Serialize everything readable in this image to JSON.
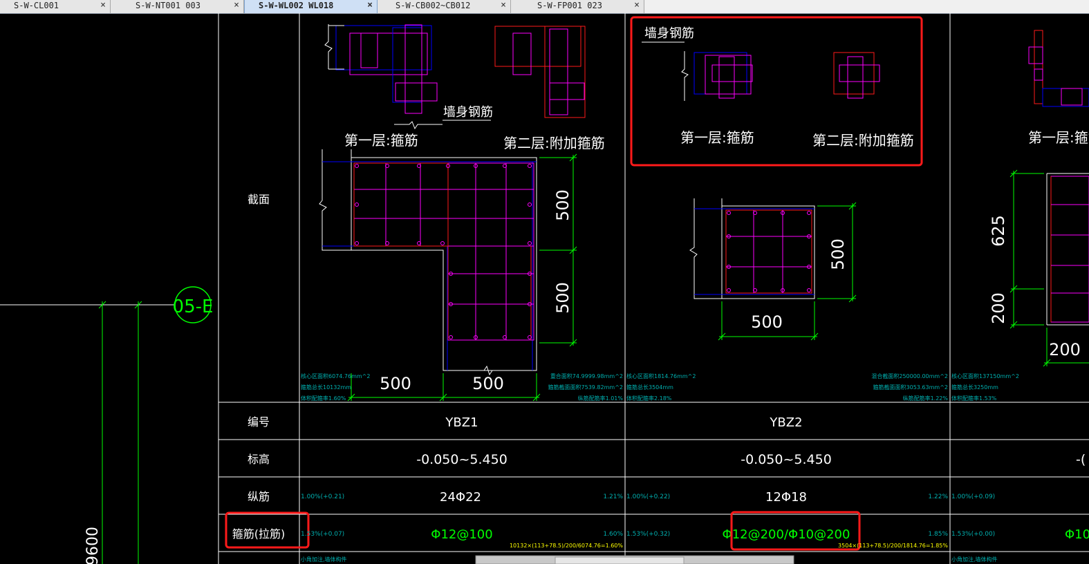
{
  "tabs": [
    {
      "label": "S-W-CL001",
      "active": false
    },
    {
      "label": "S-W-NT001 003",
      "active": false
    },
    {
      "label": "S-W-WL002 WL018",
      "active": true
    },
    {
      "label": "S-W-CB002~CB012",
      "active": false
    },
    {
      "label": "S-W-FP001 023",
      "active": false
    }
  ],
  "close_glyph": "×",
  "drawing": {
    "axis_bubble": "05-E",
    "left_dimension": "9600",
    "row_section": "截面",
    "row_id": "编号",
    "row_elevation": "标高",
    "row_long_bars": "纵筋",
    "row_stirrups": "箍筋(拉筋)",
    "wall_rebar": "墙身钢筋",
    "layer1": "第一层:箍筋",
    "layer2": "第二层:附加箍筋",
    "dims": {
      "d500": "500",
      "d625": "625",
      "d200": "200"
    },
    "col1": {
      "id": "YBZ1",
      "elevation": "-0.050~5.450",
      "long_bars": "24Φ22",
      "stirrups": "Φ12@100",
      "note_a": "核心区面积6074.76mm^2",
      "note_b": "箍筋总长10132mm",
      "note_c": "体积配箍率1.60%",
      "note_d": "重合面积74.9999.98mm^2",
      "note_e": "箍筋截面面积7539.82mm^2",
      "note_f": "纵筋配筋率1.01%",
      "lb_left": "1.00%(+0.21)",
      "lb_right": "1.21%",
      "st_left": "1.53%(+0.07)",
      "st_right": "1.60%",
      "calc": "10132×(113+78.5)/200/6074.76=1.60%"
    },
    "col2": {
      "id": "YBZ2",
      "elevation": "-0.050~5.450",
      "long_bars": "12Φ18",
      "stirrups": "Φ12@200/Φ10@200",
      "note_a": "核心区面积1814.76mm^2",
      "note_b": "箍筋总长3504mm",
      "note_c": "体积配箍率2.18%",
      "note_d": "混合截面积250000.00mm^2",
      "note_e": "箍筋截面面积3053.63mm^2",
      "note_f": "纵筋配筋率1.22%",
      "lb_left": "1.00%(+0.22)",
      "lb_right": "1.22%",
      "st_left": "1.53%(+0.32)",
      "st_right": "1.85%",
      "calc": "3504×(113+78.5)/200/1814.76=1.85%"
    },
    "col3": {
      "elevation_fragment": "-(",
      "stirrups_fragment": "Φ10",
      "note_a": "核心区面积137150mm^2",
      "note_b": "箍筋总长3250mm",
      "note_c": "体积配箍率1.53%",
      "lb_left": "1.00%(+0.09)",
      "st_left": "1.53%(+0.00)"
    },
    "footnote": "小角加注,墙体构件"
  },
  "colors": {
    "background": "#000000",
    "grid": "#ffffff",
    "dimension": "#00ff00",
    "annotation": "#00b0b0",
    "stirrup": "#ff00ff",
    "wall": "#0000ff",
    "highlight": "#ff1a1a",
    "calc": "#ffff00"
  }
}
